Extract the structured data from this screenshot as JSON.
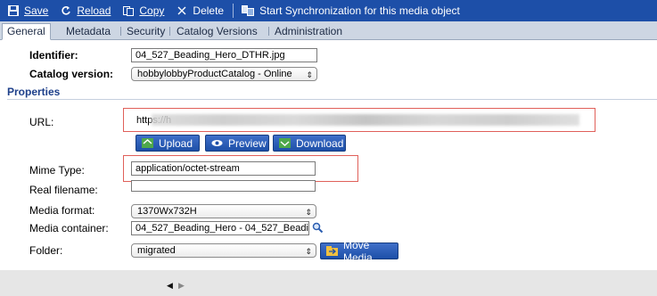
{
  "toolbar": {
    "save": "Save",
    "reload": "Reload",
    "copy": "Copy",
    "delete": "Delete",
    "sync": "Start Synchronization for this media object"
  },
  "tabs": [
    "General",
    "Metadata",
    "Security",
    "Catalog Versions",
    "Administration"
  ],
  "header": {
    "identifier_label": "Identifier:",
    "identifier_value": "04_527_Beading_Hero_DTHR.jpg",
    "catalog_label": "Catalog version:",
    "catalog_value": "hobbylobbyProductCatalog - Online"
  },
  "properties": {
    "section_title": "Properties",
    "url_label": "URL:",
    "url_value": "https://h",
    "upload": "Upload",
    "preview": "Preview",
    "download": "Download",
    "mime_label": "Mime Type:",
    "mime_value": "application/octet-stream",
    "realname_label": "Real filename:",
    "realname_value": "",
    "format_label": "Media format:",
    "format_value": "1370Wx732H",
    "container_label": "Media container:",
    "container_value": "04_527_Beading_Hero - 04_527_Beadi",
    "folder_label": "Folder:",
    "folder_value": "migrated",
    "move": "Move Media"
  },
  "footer": {
    "prev": "◀",
    "next": "▶"
  },
  "colors": {
    "toolbar": "#1d4fa8",
    "highlight": "#e0605a",
    "section": "#1d3f8a"
  }
}
